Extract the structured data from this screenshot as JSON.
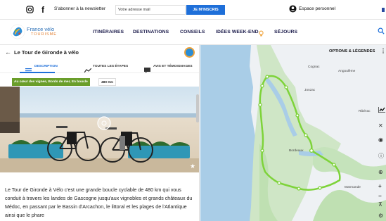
{
  "topbar": {
    "instagram_icon": "instagram-icon",
    "facebook_icon": "f",
    "newsletter_label": "S'abonner à la newsletter",
    "email_placeholder": "Votre adresse mail",
    "subscribe_button": "JE M'INSCRIS",
    "account_label": "Espace personnel"
  },
  "navbar": {
    "logo_text": "France vélo",
    "logo_sub": "TOURISME",
    "items": [
      "ITINÉRAIRES",
      "DESTINATIONS",
      "CONSEILS",
      "IDÉES WEEK-END",
      "SÉJOURS"
    ]
  },
  "panel": {
    "title": "Le Tour de Gironde à vélo",
    "tabs": [
      "DESCRIPTION",
      "TOUTES LES ÉTAPES",
      "AVIS ET TÉMOIGNAGES"
    ],
    "tag": "Au cœur des vignes, Bords de mer, En boucle",
    "distance": "480 Km",
    "description": "Le Tour de Gironde à Vélo c'est une grande boucle cyclable de 480 km qui vous conduit à travers les landes de Gascogne jusqu'aux vignobles et grands châteaux du Médoc, en passant par le Bassin d'Arcachon, le littoral et les plages de l'Atlantique ainsi que le phare"
  },
  "map": {
    "options_label": "OPTIONS & LÉGENDES",
    "places": {
      "cognac": "Cognac",
      "angouleme": "Angoulême",
      "jonzac": "Jonzac",
      "riberac": "Ribérac",
      "bordeaux": "Bordeaux",
      "marmande": "Marmande"
    }
  },
  "colors": {
    "accent": "#1e6fd9",
    "route": "#7ed33a",
    "tag": "#6a9e2a"
  }
}
